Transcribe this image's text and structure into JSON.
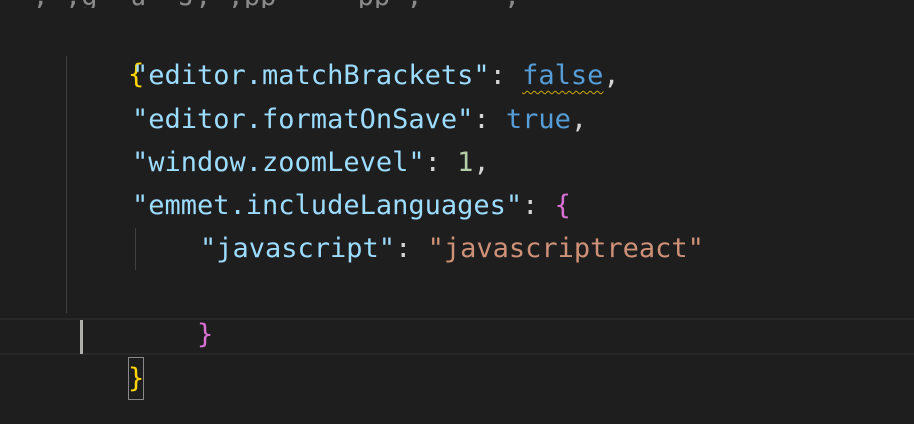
{
  "editor": {
    "top_partial_text": "  , ,g  u  J, ,pp     pp ,     ,",
    "open_brace": "{",
    "close_brace": "}",
    "settings": [
      {
        "key": "\"editor.matchBrackets\"",
        "colon": ": ",
        "value": "false",
        "value_type": "bool",
        "trailing": ","
      },
      {
        "key": "\"editor.formatOnSave\"",
        "colon": ": ",
        "value": "true",
        "value_type": "bool",
        "trailing": ","
      },
      {
        "key": "\"window.zoomLevel\"",
        "colon": ": ",
        "value": "1",
        "value_type": "number",
        "trailing": ","
      },
      {
        "key": "\"emmet.includeLanguages\"",
        "colon": ": ",
        "value": "{",
        "value_type": "object-open",
        "trailing": ""
      }
    ],
    "nested": {
      "key": "\"javascript\"",
      "colon": ": ",
      "value": "\"javascriptreact\""
    },
    "nested_close": "}",
    "warning_on": "false"
  },
  "colors": {
    "background": "#1e1e1e",
    "key": "#9cdcfe",
    "string": "#ce9178",
    "boolean": "#569cd6",
    "number": "#b5cea8",
    "brace_level1": "#ffd700",
    "brace_level2": "#da70d6",
    "warning_squiggle": "#cca700"
  }
}
